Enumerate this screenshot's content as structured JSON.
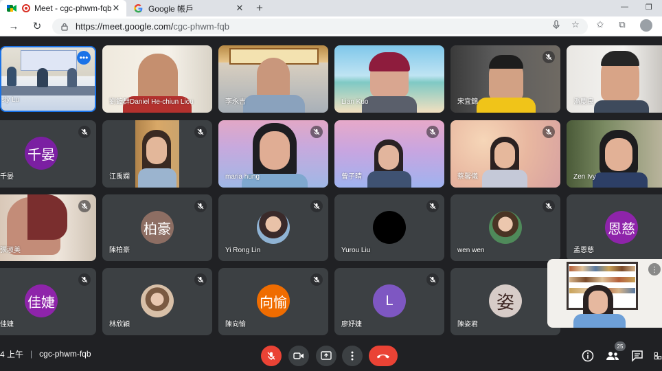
{
  "browser": {
    "tabs": [
      {
        "title": "Meet - cgc-phwm-fqb",
        "active": true
      },
      {
        "title": "Google 帳戶",
        "active": false
      }
    ],
    "url_host": "https://meet.google.com/",
    "url_path": "cgc-phwm-fqb"
  },
  "participants": [
    {
      "name": "sly Lu"
    },
    {
      "name": "劉鋐群Daniel He-chiun Liou"
    },
    {
      "name": "李永吉"
    },
    {
      "name": "Lian Kuo"
    },
    {
      "name": "宋宜錦"
    },
    {
      "name": "潘慶良"
    },
    {
      "name": "千晏",
      "initials": "千晏",
      "color": "#7b1fa2"
    },
    {
      "name": "江禹嫻"
    },
    {
      "name": "maria hung"
    },
    {
      "name": "曾子晴"
    },
    {
      "name": "蔡馨儀"
    },
    {
      "name": "Zen Ivy"
    },
    {
      "name": "張淑美"
    },
    {
      "name": "陳柏豪",
      "initials": "柏豪",
      "color": "#8d6e63"
    },
    {
      "name": "Yi Rong Lin"
    },
    {
      "name": "Yurou Liu"
    },
    {
      "name": "wen wen"
    },
    {
      "name": "孟恩慈",
      "initials": "恩慈",
      "color": "#8e24aa"
    },
    {
      "name": "佳婕",
      "initials": "佳婕",
      "color": "#8e24aa"
    },
    {
      "name": "林欣穎"
    },
    {
      "name": "陳向愉",
      "initials": "向愉",
      "color": "#ef6c00"
    },
    {
      "name": "廖妤婕",
      "initials": "L",
      "color": "#7e57c2"
    },
    {
      "name": "陳姿君",
      "initials": "姿",
      "color": "#d7ccc8"
    }
  ],
  "bottom_bar": {
    "time": "4 上午",
    "meeting_code": "cgc-phwm-fqb",
    "participant_count": "25"
  },
  "colors": {
    "background": "#202124",
    "tile": "#3c4043",
    "hangup_red": "#ea4335",
    "accent_blue": "#1a73e8"
  }
}
